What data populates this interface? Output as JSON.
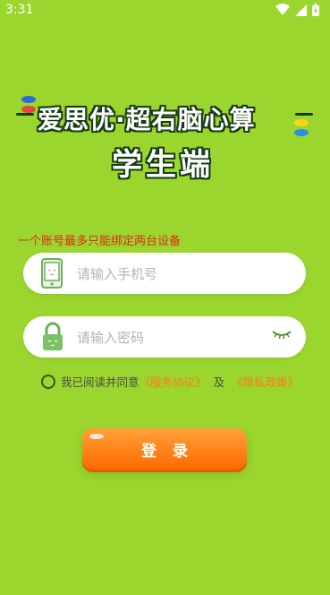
{
  "status_bar": {
    "time": "3:31"
  },
  "header": {
    "title_line1": "爱思优·超右脑心算",
    "title_line2": "学生端"
  },
  "notice": "一个账号最多只能绑定两台设备",
  "phone_field": {
    "placeholder": "请输入手机号",
    "icon": "phone-icon"
  },
  "password_field": {
    "placeholder": "请输入密码",
    "icon": "lock-icon",
    "toggle_icon": "eye-closed-icon"
  },
  "agreement": {
    "text": "我已阅读并同意",
    "service": "《服务协议》",
    "and": "及",
    "privacy": "《隐私政策》"
  },
  "login_button": {
    "label": "登录"
  },
  "colors": {
    "background": "#9bd62e",
    "accent": "#ff7a18",
    "notice": "#e02a18"
  }
}
